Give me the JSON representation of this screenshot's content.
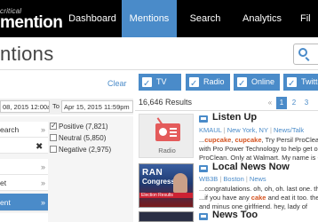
{
  "brand": {
    "small": "critical",
    "big": "mention"
  },
  "nav": {
    "items": [
      {
        "label": "Dashboard",
        "active": false
      },
      {
        "label": "Mentions",
        "active": true
      },
      {
        "label": "Search",
        "active": false
      },
      {
        "label": "Analytics",
        "active": false
      },
      {
        "label": "Fil",
        "active": false
      }
    ]
  },
  "page": {
    "title": "ntions"
  },
  "filters": {
    "clear_label": "Clear",
    "date_from": "08, 2015 12:00am",
    "to_label": "To",
    "date_to": "Apr 15, 2015 11:59pm",
    "left_items": [
      {
        "label": "earch",
        "active": false
      },
      {
        "label": "",
        "active": false
      },
      {
        "label": "",
        "active": false
      },
      {
        "label": "et",
        "active": false
      },
      {
        "label": "",
        "active": false
      },
      {
        "label": "ent",
        "active": true
      }
    ],
    "sentiment": [
      {
        "label": "Positive (7,821)",
        "checked": true
      },
      {
        "label": "Neutral (5,850)",
        "checked": false
      },
      {
        "label": "Negative (2,975)",
        "checked": false
      }
    ]
  },
  "media_tabs": [
    {
      "label": "TV",
      "checked": true
    },
    {
      "label": "Radio",
      "checked": true
    },
    {
      "label": "Online",
      "checked": true
    },
    {
      "label": "Twitter",
      "checked": true
    }
  ],
  "results": {
    "count": "16,646 Results",
    "pager": {
      "prev": "«",
      "pages": [
        "1",
        "2",
        "3"
      ],
      "current": "1"
    },
    "items": [
      {
        "title": "Listen Up",
        "thumb_label": "Radio",
        "source": "KMAUL",
        "location": "New York, NY",
        "category": "News/Talk",
        "snippet_lines": [
          [
            "...",
            "cupcake",
            ", ",
            "cupcake",
            ", Try Persil ProClean. You"
          ],
          [
            "with Pro Power Technology to help get out the"
          ],
          [
            "ProClean. Only at Walmart. My name is Cap"
          ]
        ]
      },
      {
        "title": "Local News Now",
        "thumb_text_1": "RAN",
        "thumb_text_2": "Congress",
        "thumb_caption": "Election Results",
        "source": "WB3B",
        "location": "Boston",
        "category": "News",
        "snippet_lines": [
          [
            "...congratulations. oh, oh, oh. last one. that"
          ],
          [
            "...if you have any ",
            "cake",
            " and eat it too. then sudden"
          ],
          [
            "and minus one girlfriend. hey, lady of"
          ]
        ]
      },
      {
        "title": "News Too"
      }
    ]
  },
  "colors": {
    "accent": "#4a8bc9",
    "topbar": "#000000",
    "highlight": "#d4521f"
  }
}
